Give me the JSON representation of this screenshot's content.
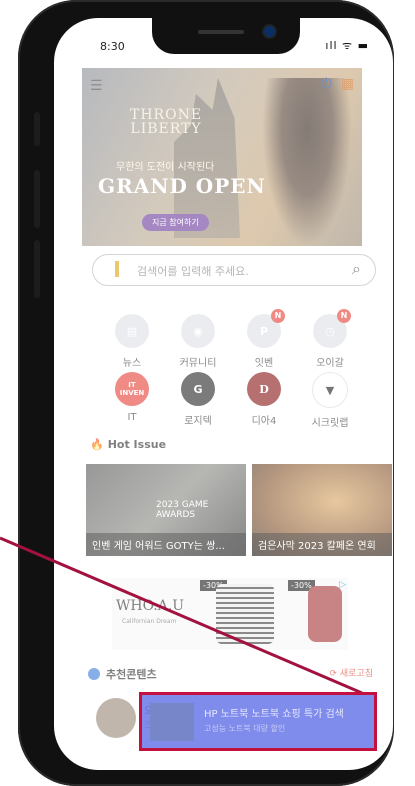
{
  "status": {
    "time": "8:30",
    "icons": "ıll ᯤ ▬"
  },
  "banner": {
    "logo_line1": "THRONE",
    "logo_line2": "LIBERTY",
    "subtitle": "무한의 도전이 시작된다",
    "headline": "GRAND OPEN",
    "cta": "지금 참여하기"
  },
  "search": {
    "placeholder": "검색어를 입력해 주세요."
  },
  "shortcuts": [
    {
      "label": "뉴스",
      "glyph": "▤",
      "color": "#cfd3da",
      "badge": ""
    },
    {
      "label": "커뮤니티",
      "glyph": "◉",
      "color": "#cfd3da",
      "badge": ""
    },
    {
      "label": "잇벤",
      "glyph": "P",
      "color": "#cfd3da",
      "badge": "N"
    },
    {
      "label": "오이갈",
      "glyph": "◷",
      "color": "#cfd3da",
      "badge": "N"
    },
    {
      "label": "IT",
      "glyph": "IT\nINVEN",
      "color": "#e8443a",
      "badge": ""
    },
    {
      "label": "로지텍",
      "glyph": "G",
      "color": "#2b2b2b",
      "badge": ""
    },
    {
      "label": "디아4",
      "glyph": "D",
      "color": "#8b1a1a",
      "badge": ""
    },
    {
      "label": "시크릿랩",
      "glyph": "▼",
      "color": "#ffffff",
      "badge": ""
    }
  ],
  "hot_issue": {
    "title": "Hot Issue",
    "cards": [
      {
        "caption": "인벤 게임 어워드 GOTY는 쌍...",
        "overlay": "2023 GAME AWARDS"
      },
      {
        "caption": "검은사막 2023 칼페온 연회"
      }
    ]
  },
  "ad": {
    "brand": "WHO.A.U",
    "brand_sub": "Californian Dream",
    "tag1": "-30%",
    "tag2": "-30%"
  },
  "recommend": {
    "title": "추천콘텐츠",
    "refresh": "새로고침",
    "item_prefix": "오",
    "item_sub": "크"
  },
  "overlay": {
    "line1": "HP 노트북 노트북 쇼핑 특가 검색",
    "line2": "고성능 노트북 대량 할인"
  }
}
